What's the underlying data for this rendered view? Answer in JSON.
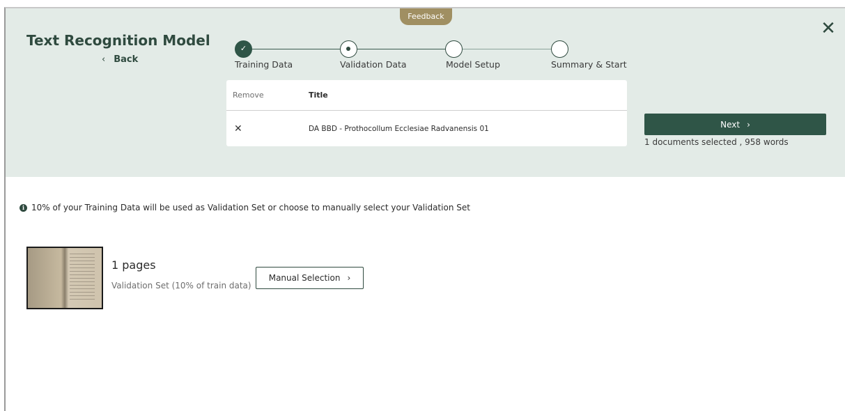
{
  "feedback_label": "Feedback",
  "header": {
    "title": "Text Recognition Model",
    "back_label": "Back",
    "back_chevron": "‹",
    "close_glyph": "✕"
  },
  "stepper": {
    "steps": [
      {
        "label": "Training Data",
        "state": "done"
      },
      {
        "label": "Validation Data",
        "state": "current"
      },
      {
        "label": "Model Setup",
        "state": "upcoming"
      },
      {
        "label": "Summary & Start",
        "state": "upcoming"
      }
    ],
    "check_glyph": "✓"
  },
  "table": {
    "headers": {
      "remove": "Remove",
      "title": "Title"
    },
    "rows": [
      {
        "remove_glyph": "✕",
        "title": "DA BBD - Prothocollum Ecclesiae Radvanensis 01"
      }
    ]
  },
  "next_button": {
    "label": "Next",
    "chevron": "›"
  },
  "selection_info": "1 documents selected , 958 words",
  "info": {
    "icon": "info-icon",
    "icon_glyph": "i",
    "text": "10% of your Training Data will be used as Validation Set or choose to manually select your Validation Set"
  },
  "validation_set": {
    "pages": "1 pages",
    "subtext": "Validation Set (10% of train data)"
  },
  "manual_button": {
    "label": "Manual Selection",
    "chevron": "›"
  },
  "colors": {
    "header_bg": "#e3ebe7",
    "accent": "#2f5547",
    "feedback": "#a08f62"
  }
}
